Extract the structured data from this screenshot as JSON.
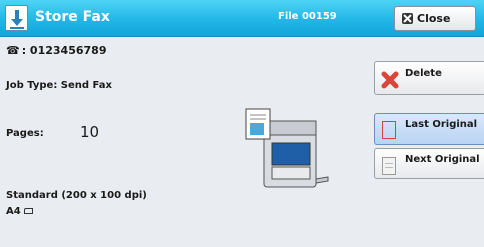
{
  "header": {
    "title": "Store Fax",
    "file_name": "File 00159",
    "close_label": "Close",
    "title_icon": "download-icon"
  },
  "info": {
    "phone_icon": "phone-icon",
    "fax_number": ": 0123456789",
    "job_type": "Job Type: Send Fax",
    "pages_label": "Pages:",
    "pages_value": "10",
    "resolution": "Standard (200 x 100 dpi)",
    "paper_size": "A4"
  },
  "actions": {
    "delete_label": "Delete",
    "last_original_label": "Last Original",
    "next_original_label": "Next Original"
  },
  "colors": {
    "titlebar": "#21b7e7",
    "background": "#e9ecf0",
    "selected_button": "#c6dcf6",
    "delete_icon": "#d9453a"
  }
}
